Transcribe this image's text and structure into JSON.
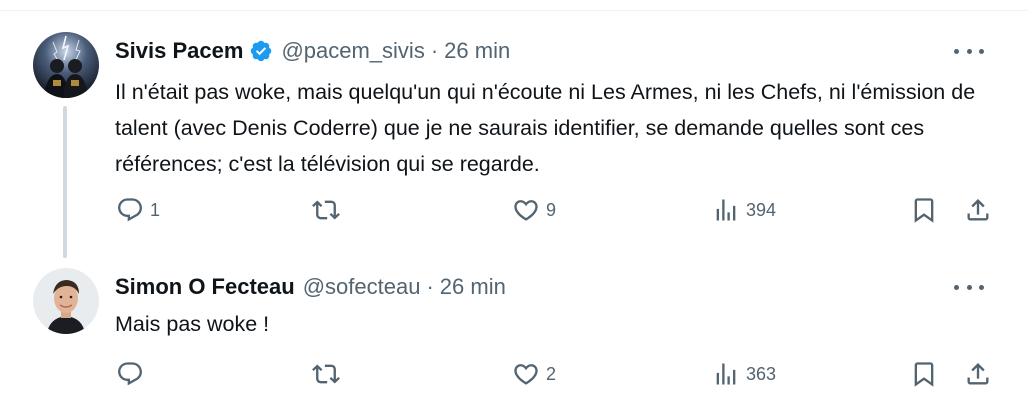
{
  "tweets": [
    {
      "name": "Sivis Pacem",
      "verified": true,
      "handle": "@pacem_sivis",
      "separator": "·",
      "time": "26 min",
      "text": "Il n'était pas woke, mais quelqu'un qui n'écoute ni Les Armes, ni les Chefs, ni l'émission de talent (avec Denis Coderre) que je ne saurais identifier, se demande quelles sont ces références; c'est la télévision qui se regarde.",
      "replies": "1",
      "retweets": "",
      "likes": "9",
      "views": "394"
    },
    {
      "name": "Simon O Fecteau",
      "verified": false,
      "handle": "@sofecteau",
      "separator": "·",
      "time": "26 min",
      "text": "Mais pas woke !",
      "replies": "",
      "retweets": "",
      "likes": "2",
      "views": "363"
    }
  ],
  "colors": {
    "text": "#0f1419",
    "secondary": "#536471",
    "verified": "#1d9bf0",
    "thread_line": "#cfd9de"
  },
  "icons": [
    "reply-icon",
    "retweet-icon",
    "like-icon",
    "views-icon",
    "bookmark-icon",
    "share-icon",
    "more-icon",
    "verified-badge-icon"
  ]
}
